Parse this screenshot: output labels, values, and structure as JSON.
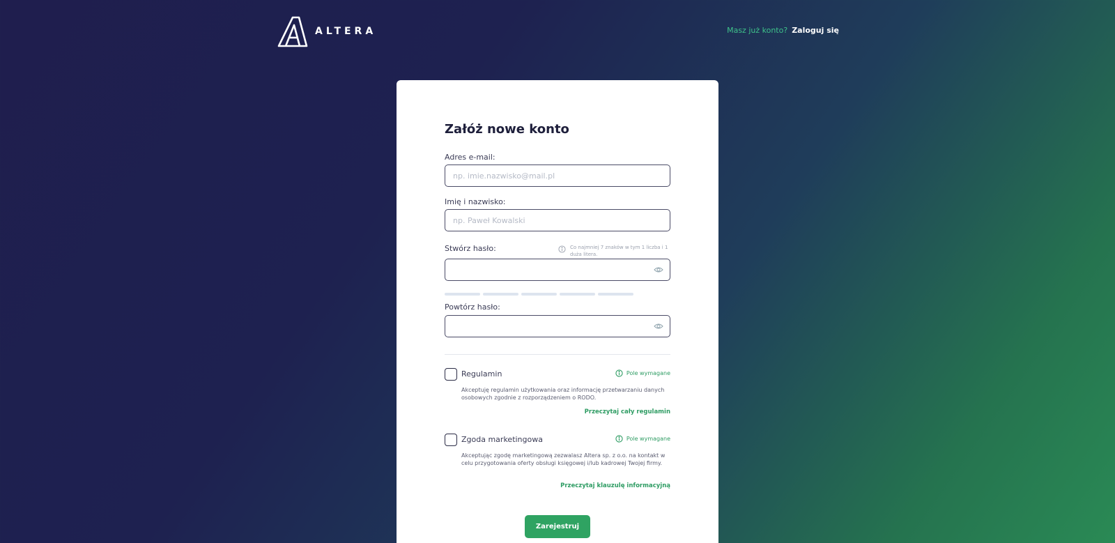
{
  "header": {
    "logo_text": "ALTERA",
    "login_question": "Masz już konto?",
    "login_link": "Zaloguj się"
  },
  "form": {
    "title": "Załóż nowe konto",
    "email": {
      "label": "Adres e-mail:",
      "placeholder": "np. imie.nazwisko@mail.pl"
    },
    "name": {
      "label": "Imię i nazwisko:",
      "placeholder": "np. Paweł Kowalski"
    },
    "password": {
      "label": "Stwórz hasło:",
      "hint": "Co najmniej 7 znaków w tym 1 liczba i 1 duża litera."
    },
    "password_repeat": {
      "label": "Powtórz hasło:"
    },
    "terms": {
      "title": "Regulamin",
      "required": "Pole wymagane",
      "description": "Akceptuję regulamin użytkowania oraz informację przetwarzaniu danych osobowych zgodnie z rozporządzeniem o RODO.",
      "link": "Przeczytaj cały regulamin"
    },
    "marketing": {
      "title": "Zgoda marketingowa",
      "required": "Pole wymagane",
      "description": "Akceptując zgodę marketingową zezwalasz Altera sp. z o.o. na kontakt w celu przygotowania oferty obsługi księgowej i/lub kadrowej Twojej firmy.",
      "link": "Przeczytaj klauzulę informacyjną"
    },
    "submit_label": "Zarejestruj"
  },
  "colors": {
    "accent": "#2fa362",
    "accent_text": "#3ec28a",
    "background_dark": "#1f1e4e",
    "background_green": "#2a8a55"
  },
  "icons": [
    "altera-logo-icon",
    "info-icon",
    "eye-icon"
  ]
}
